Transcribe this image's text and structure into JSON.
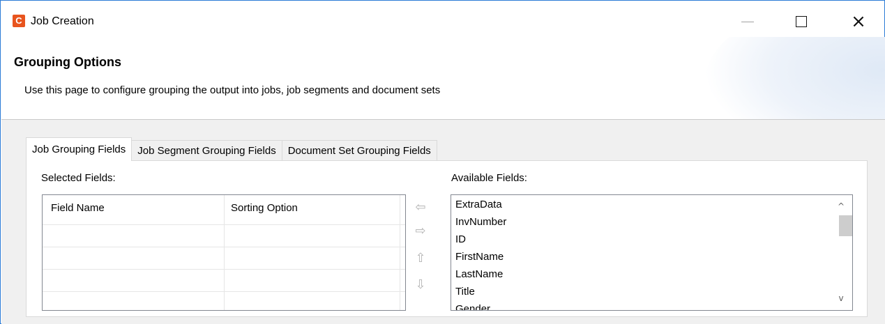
{
  "window": {
    "title": "Job Creation",
    "app_icon_letter": "C",
    "controls": [
      "minimize",
      "maximize",
      "close"
    ]
  },
  "header": {
    "title": "Grouping Options",
    "description": "Use this page to configure grouping the output into jobs, job segments and document sets"
  },
  "tabs": [
    {
      "label": "Job Grouping Fields",
      "active": true
    },
    {
      "label": "Job Segment Grouping Fields",
      "active": false
    },
    {
      "label": "Document Set Grouping Fields",
      "active": false
    }
  ],
  "selected_fields": {
    "label": "Selected Fields:",
    "columns": [
      "Field Name",
      "Sorting Option"
    ],
    "rows": []
  },
  "available_fields": {
    "label": "Available Fields:",
    "items": [
      "ExtraData",
      "InvNumber",
      "ID",
      "FirstName",
      "LastName",
      "Title",
      "Gender"
    ]
  },
  "move_buttons": {
    "add": "⇦",
    "remove": "⇨",
    "up": "⇧",
    "down": "⇩"
  },
  "colors": {
    "window_border": "#2b7bd6",
    "app_icon": "#e8541e",
    "panel_bg": "#f0f0f0"
  }
}
